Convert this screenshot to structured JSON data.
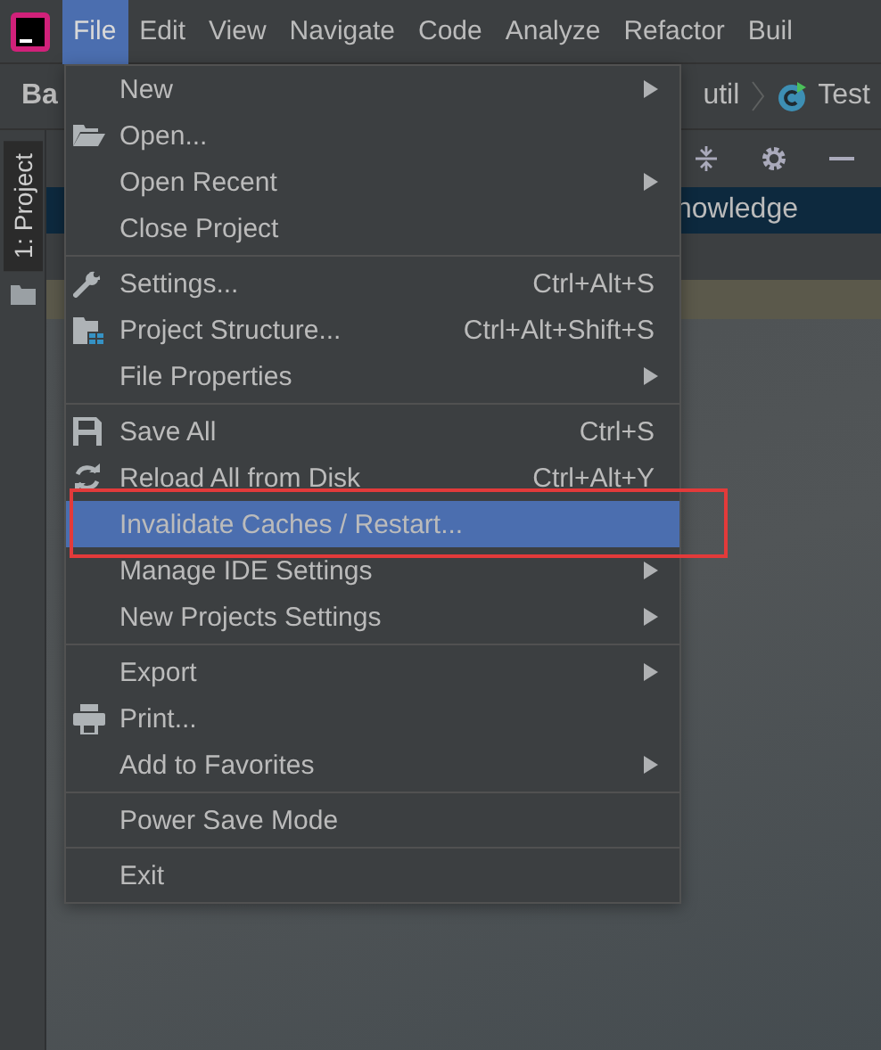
{
  "menubar": [
    {
      "label": "File",
      "selected": true
    },
    {
      "label": "Edit",
      "selected": false
    },
    {
      "label": "View",
      "selected": false
    },
    {
      "label": "Navigate",
      "selected": false
    },
    {
      "label": "Code",
      "selected": false
    },
    {
      "label": "Analyze",
      "selected": false
    },
    {
      "label": "Refactor",
      "selected": false
    },
    {
      "label": "Buil",
      "selected": false
    }
  ],
  "breadcrumb": {
    "project": "Ba",
    "package": "util",
    "file": "Test"
  },
  "tool_window_tab": "1: Project",
  "tree_row": "nowledge",
  "file_menu": [
    {
      "kind": "item",
      "label": "New",
      "submenu": true,
      "selected": false
    },
    {
      "kind": "item",
      "label": "Open...",
      "submenu": false,
      "selected": false
    },
    {
      "kind": "item",
      "label": "Open Recent",
      "submenu": true,
      "selected": false
    },
    {
      "kind": "item",
      "label": "Close Project",
      "submenu": false,
      "selected": false
    },
    {
      "kind": "separator"
    },
    {
      "kind": "item",
      "label": "Settings...",
      "shortcut": "Ctrl+Alt+S",
      "submenu": false,
      "selected": false
    },
    {
      "kind": "item",
      "label": "Project Structure...",
      "shortcut": "Ctrl+Alt+Shift+S",
      "submenu": false,
      "selected": false
    },
    {
      "kind": "item",
      "label": "File Properties",
      "submenu": true,
      "selected": false
    },
    {
      "kind": "separator"
    },
    {
      "kind": "item",
      "label": "Save All",
      "shortcut": "Ctrl+S",
      "submenu": false,
      "selected": false
    },
    {
      "kind": "item",
      "label": "Reload All from Disk",
      "shortcut": "Ctrl+Alt+Y",
      "submenu": false,
      "selected": false
    },
    {
      "kind": "item",
      "label": "Invalidate Caches / Restart...",
      "submenu": false,
      "selected": true,
      "annotated": true
    },
    {
      "kind": "item",
      "label": "Manage IDE Settings",
      "submenu": true,
      "selected": false
    },
    {
      "kind": "item",
      "label": "New Projects Settings",
      "submenu": true,
      "selected": false
    },
    {
      "kind": "separator"
    },
    {
      "kind": "item",
      "label": "Export",
      "submenu": true,
      "selected": false
    },
    {
      "kind": "item",
      "label": "Print...",
      "submenu": false,
      "selected": false
    },
    {
      "kind": "item",
      "label": "Add to Favorites",
      "submenu": true,
      "selected": false
    },
    {
      "kind": "separator"
    },
    {
      "kind": "item",
      "label": "Power Save Mode",
      "submenu": false,
      "selected": false
    },
    {
      "kind": "separator"
    },
    {
      "kind": "item",
      "label": "Exit",
      "submenu": false,
      "selected": false
    }
  ]
}
